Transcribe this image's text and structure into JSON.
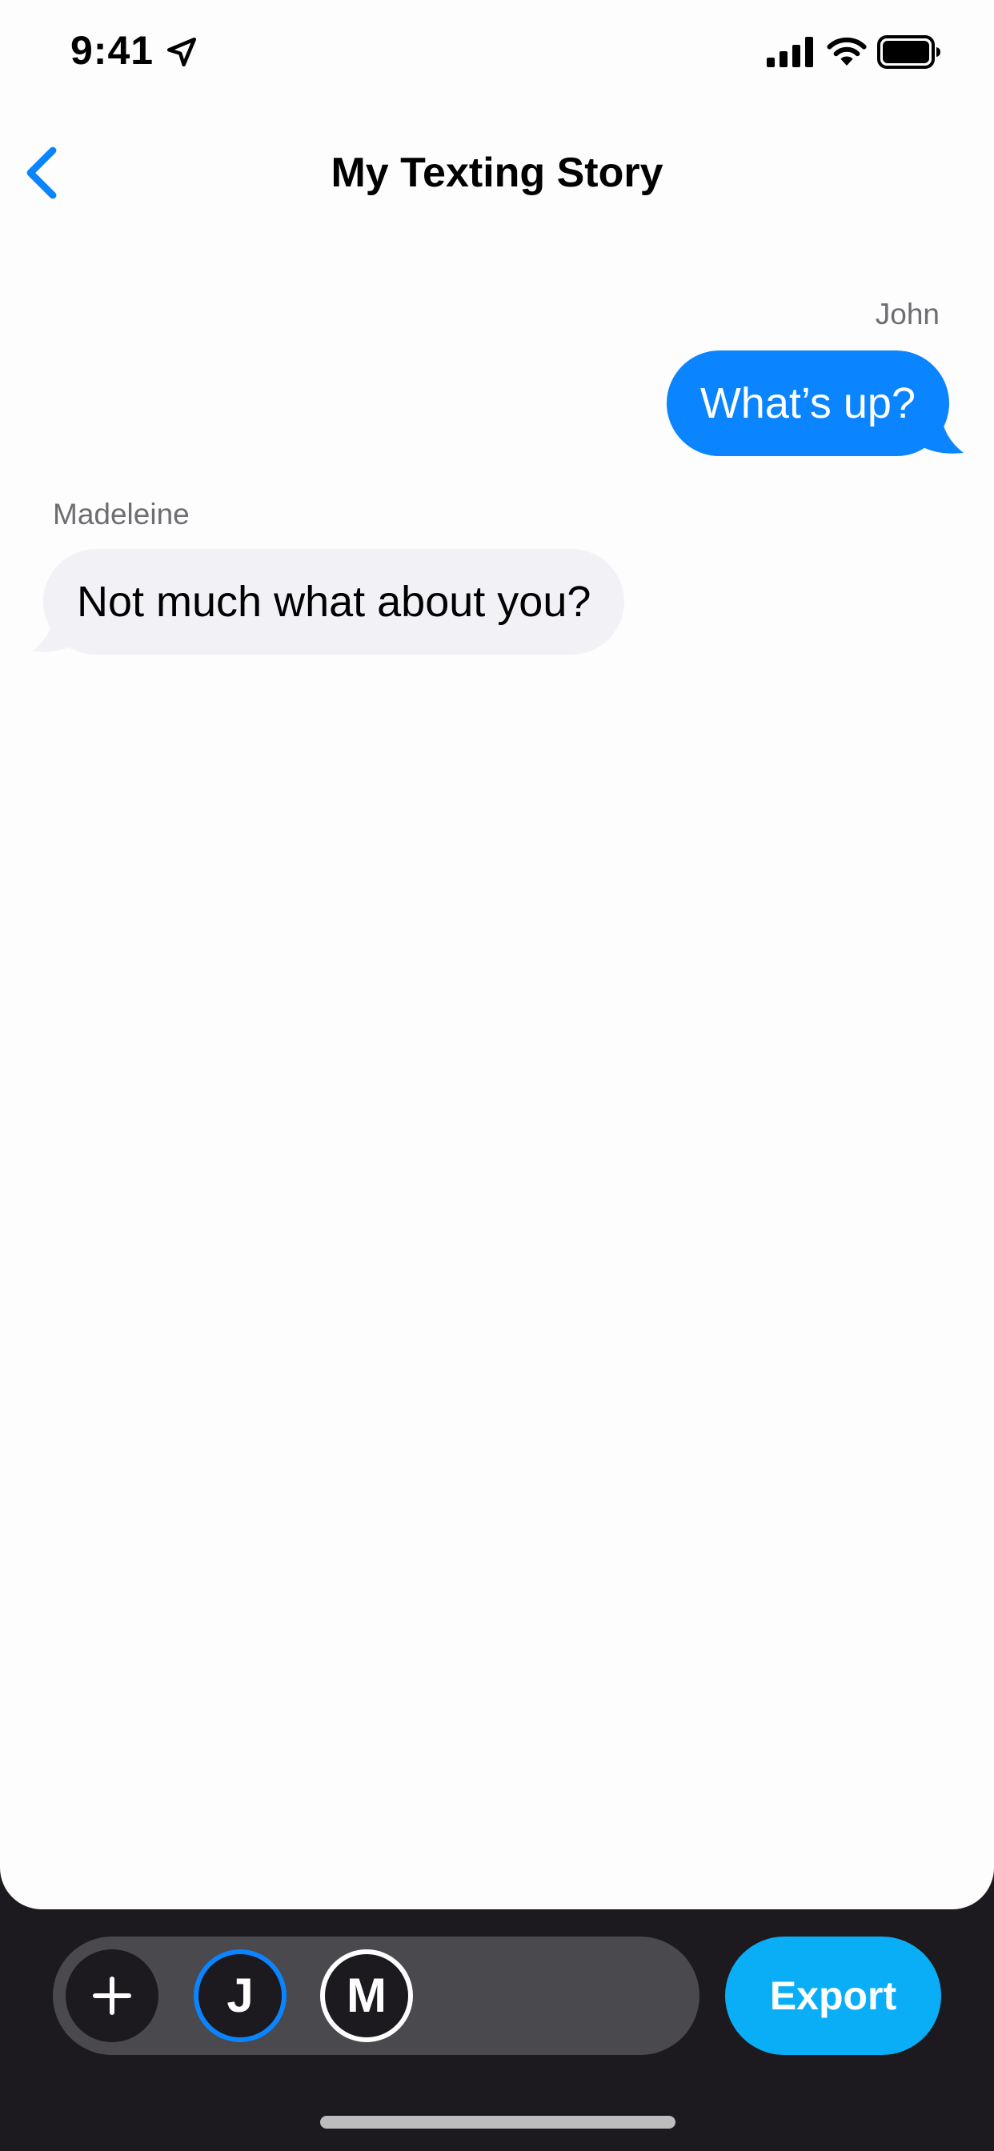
{
  "status_bar": {
    "time": "9:41",
    "icons": [
      "location-arrow-icon",
      "cellular-signal-icon",
      "wifi-icon",
      "battery-icon"
    ]
  },
  "nav": {
    "back_icon": "chevron-left-icon",
    "title": "My Texting Story"
  },
  "messages": [
    {
      "sender": "John",
      "text": "What’s up?",
      "direction": "outgoing"
    },
    {
      "sender": "Madeleine",
      "text": "Not much what about you?",
      "direction": "incoming"
    }
  ],
  "toolbar": {
    "add_icon": "plus-icon",
    "participants": [
      {
        "initial": "J",
        "selected": true
      },
      {
        "initial": "M",
        "selected": false
      }
    ],
    "export_label": "Export"
  },
  "colors": {
    "accent": "#0a84ff",
    "export_button": "#0aaef7",
    "incoming_bubble": "#f2f2f6",
    "toolbar_bg": "#1c1a1f",
    "toolbar_pill": "#4a494d",
    "sender_label": "#6d6d72"
  }
}
